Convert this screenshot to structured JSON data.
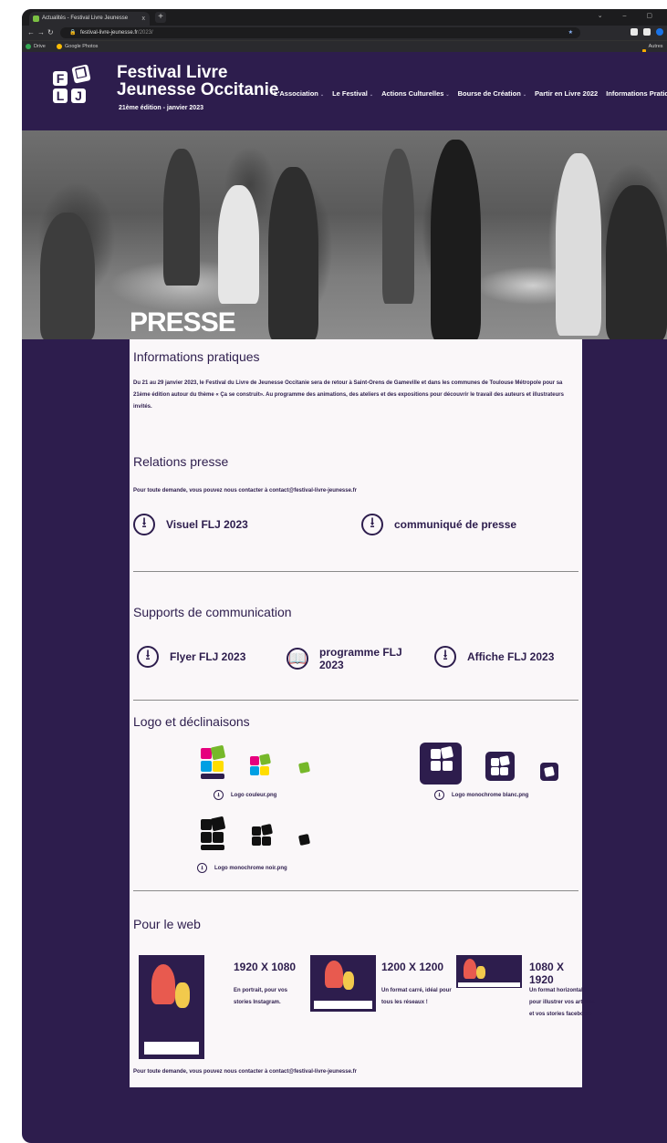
{
  "browser": {
    "tab_title": "Actualités - Festival Livre Jeunesse",
    "tab_close": "x",
    "new_tab": "+",
    "url_host": "festival-livre-jeunesse.fr",
    "url_path": "/2023/",
    "bookmarks": [
      "Drive",
      "Google Photos"
    ],
    "bookmarks_right": "Autres favoris"
  },
  "site": {
    "title_line1": "Festival Livre",
    "title_line2": "Jeunesse Occitanie",
    "subtitle": "21ème édition - janvier 2023",
    "logo_letters": [
      "F",
      "L",
      "J"
    ],
    "nav": [
      {
        "label": "L'Association",
        "dropdown": true
      },
      {
        "label": "Le Festival",
        "dropdown": true
      },
      {
        "label": "Actions Culturelles",
        "dropdown": true
      },
      {
        "label": "Bourse de Création",
        "dropdown": true
      },
      {
        "label": "Partir en Livre 2022",
        "dropdown": false
      },
      {
        "label": "Informations Pratiques",
        "dropdown": true
      }
    ]
  },
  "hero": {
    "title": "PRESSE"
  },
  "info": {
    "heading": "Informations pratiques",
    "text": "Du 21 au 29 janvier 2023, le Festival du Livre de Jeunesse Occitanie sera de retour à Saint-Orens de Gameville et dans les communes de Toulouse Métropole pour sa 21ème édition  autour du thème « Ça se construit». Au programme des animations, des ateliers et des expositions pour découvrir le travail des auteurs et illustrateurs invités."
  },
  "press": {
    "heading": "Relations presse",
    "contact": "Pour toute demande, vous pouvez nous contacter à contact@festival-livre-jeunesse.fr",
    "downloads": [
      {
        "label": "Visuel FLJ 2023",
        "icon": "download-icon"
      },
      {
        "label": "communiqué de presse",
        "icon": "download-icon"
      }
    ]
  },
  "supports": {
    "heading": "Supports de communication",
    "downloads": [
      {
        "label": "Flyer FLJ 2023",
        "icon": "download-icon"
      },
      {
        "label": "programme FLJ 2023",
        "icon": "book-icon"
      },
      {
        "label": "Affiche FLJ 2023",
        "icon": "download-icon"
      }
    ]
  },
  "logos": {
    "heading": "Logo et déclinaisons",
    "items": [
      {
        "label": "Logo couleur.png"
      },
      {
        "label": "Logo monochrome blanc.png"
      },
      {
        "label": "Logo monochrome noir.png"
      }
    ]
  },
  "web": {
    "heading": "Pour le web",
    "formats": [
      {
        "title": "1920 X 1080",
        "desc": "En portrait, pour vos stories Instagram."
      },
      {
        "title": "1200 X 1200",
        "desc": "Un format carré, idéal pour tous les réseaux !"
      },
      {
        "title": "1080 X 1920",
        "desc": "Un format horizontal, pour illustrer vos articles et vos stories facebook!"
      }
    ],
    "contact": "Pour toute demande, vous pouvez nous contacter à contact@festival-livre-jeunesse.fr"
  },
  "colors": {
    "brand": "#2d1d4d",
    "panel": "#faf7f9",
    "logo_pink": "#e6007e",
    "logo_blue": "#009fe3",
    "logo_yellow": "#ffdd00",
    "logo_green": "#76b82a"
  }
}
